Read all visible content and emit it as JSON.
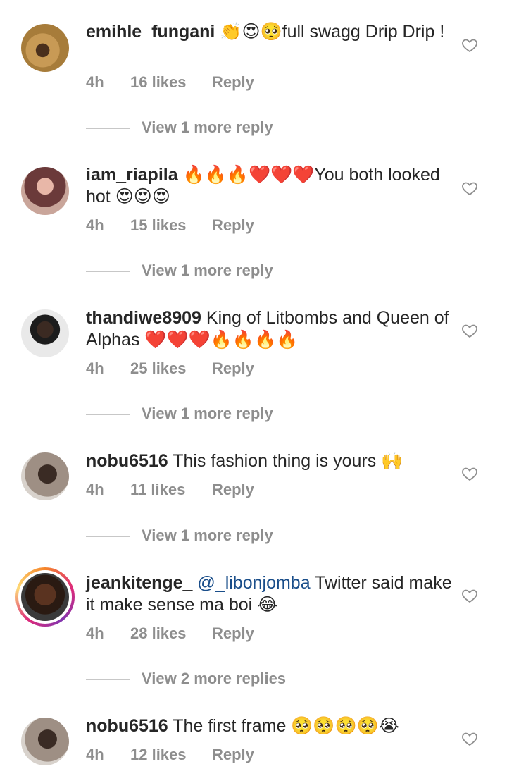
{
  "comments": [
    {
      "username": "emihle_fungani",
      "text": "👏😍🥺full swagg Drip Drip !",
      "time": "4h",
      "likes": "16 likes",
      "reply": "Reply",
      "view_more": "View 1 more reply"
    },
    {
      "username": "iam_riapila",
      "text": "🔥🔥🔥❤️❤️❤️You both looked hot 😍😍😍",
      "time": "4h",
      "likes": "15 likes",
      "reply": "Reply",
      "view_more": "View 1 more reply"
    },
    {
      "username": "thandiwe8909",
      "text": "King of Litbombs and Queen of Alphas ❤️❤️❤️🔥🔥🔥🔥",
      "time": "4h",
      "likes": "25 likes",
      "reply": "Reply",
      "view_more": "View 1 more reply"
    },
    {
      "username": "nobu6516",
      "text": "This fashion thing is yours 🙌",
      "time": "4h",
      "likes": "11 likes",
      "reply": "Reply",
      "view_more": "View 1 more reply"
    },
    {
      "username": "jeankitenge_",
      "mention": "@_libonjomba",
      "text": "Twitter said make it make sense ma boi 😂",
      "time": "4h",
      "likes": "28 likes",
      "reply": "Reply",
      "view_more": "View 2 more replies"
    },
    {
      "username": "nobu6516",
      "text": "The first frame 🥺🥺🥺🥺😭",
      "time": "4h",
      "likes": "12 likes",
      "reply": "Reply"
    }
  ],
  "colors": {
    "meta_text": "#8e8e8e",
    "mention": "#1a4e8a",
    "story_ring": "#dd2a7b"
  },
  "icons": {
    "like": "heart-outline-icon"
  }
}
